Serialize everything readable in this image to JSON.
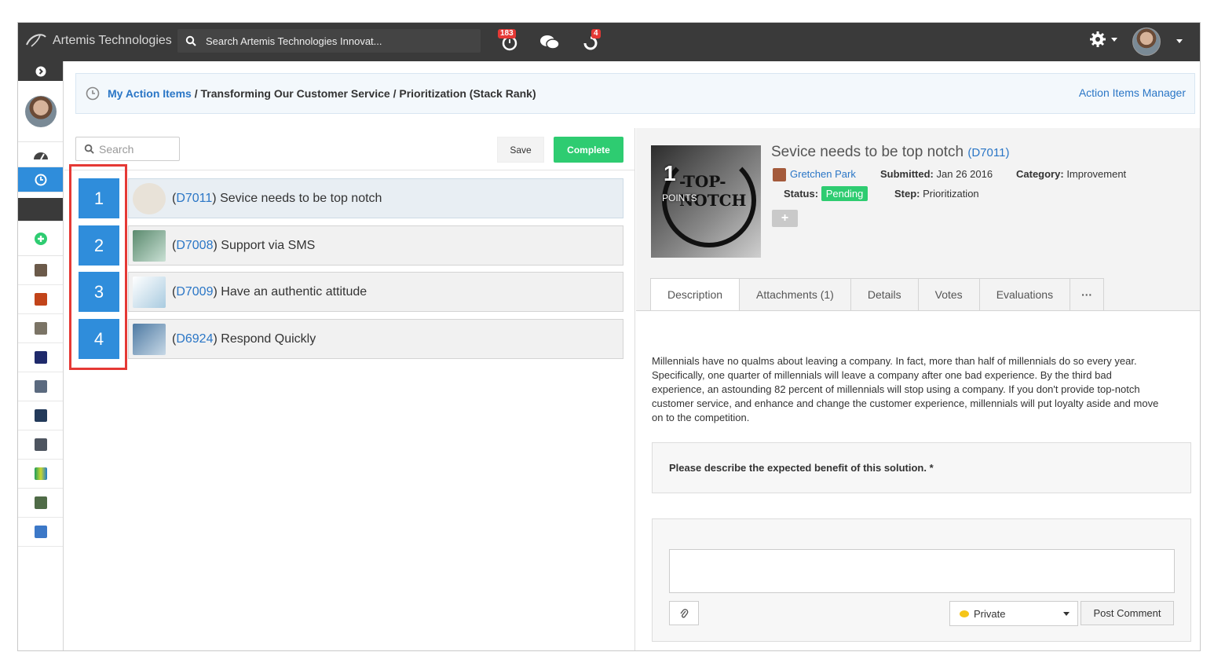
{
  "app": {
    "name": "Artemis Technologies"
  },
  "search": {
    "placeholder": "Search Artemis Technologies Innovat..."
  },
  "topbar": {
    "notifications_count": "183",
    "alerts_count": "4"
  },
  "breadcrumb": {
    "link": "My Action Items",
    "path": "/ Transforming Our Customer Service / Prioritization (Stack Rank)",
    "manager_link": "Action Items Manager"
  },
  "list": {
    "search_placeholder": "Search",
    "save_label": "Save",
    "complete_label": "Complete",
    "items": [
      {
        "rank": "1",
        "code": "D7011",
        "title": "Sevice needs to be top notch",
        "thumb": "#e8e2d8"
      },
      {
        "rank": "2",
        "code": "D7008",
        "title": "Support via SMS",
        "thumb": "#8fc1b1"
      },
      {
        "rank": "3",
        "code": "D7009",
        "title": "Have an authentic attitude",
        "thumb": "#cfe3ef"
      },
      {
        "rank": "4",
        "code": "D6924",
        "title": "Respond Quickly",
        "thumb": "#6f96b8"
      }
    ]
  },
  "detail": {
    "title": "Sevice needs to be top notch",
    "code": "D7011",
    "points": "1",
    "points_label": "POINTS",
    "image_text_1": "-TOP-",
    "image_text_2": "NOTCH",
    "author": "Gretchen Park",
    "submitted_label": "Submitted:",
    "submitted": "Jan 26 2016",
    "category_label": "Category:",
    "category": "Improvement",
    "status_label": "Status:",
    "status": "Pending",
    "step_label": "Step:",
    "step": "Prioritization",
    "plus_label": "+",
    "tabs": [
      "Description",
      "Attachments (1)",
      "Details",
      "Votes",
      "Evaluations",
      "···"
    ],
    "description": "Millennials have no qualms about leaving a company. In fact, more than half of millennials do so every year. Specifically, one quarter of millennials will leave a company after one bad experience. By the third bad experience, an astounding 82 percent of millennials will stop using a company. If you don't provide top-notch customer service, and enhance and change the customer experience, millennials will put loyalty aside and move on to the competition.",
    "benefit_prompt": "Please describe the expected benefit of this solution. *",
    "privacy": "Private",
    "post_label": "Post Comment"
  },
  "colors": {
    "accent": "#2f8ddb",
    "success": "#2ecc71",
    "danger": "#e53935",
    "topbar": "#3a3a3a"
  }
}
